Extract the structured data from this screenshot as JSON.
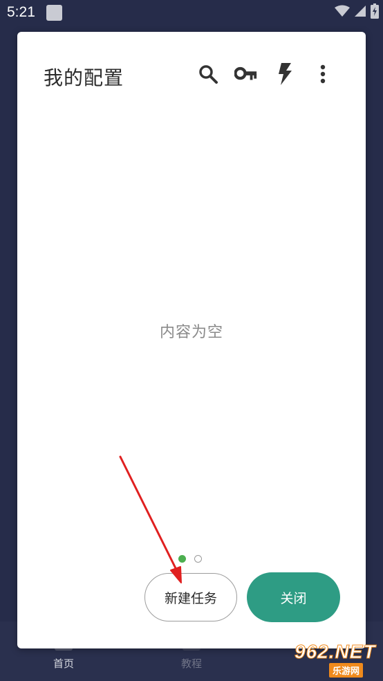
{
  "status_bar": {
    "time": "5:21",
    "icons": [
      "notification-square-icon",
      "wifi-icon",
      "signal-icon",
      "battery-charging-icon"
    ]
  },
  "bottom_nav": {
    "items": [
      {
        "label": "首页",
        "icon": "home-icon"
      },
      {
        "label": "教程",
        "icon": "tutorial-icon"
      }
    ]
  },
  "dialog": {
    "title": "我的配置",
    "toolbar_icons": [
      "search-icon",
      "key-icon",
      "flash-icon",
      "more-vert-icon"
    ],
    "empty_message": "内容为空",
    "pager": {
      "pages": 2,
      "current": 1
    },
    "buttons": {
      "new_task": "新建任务",
      "close": "关闭"
    }
  },
  "colors": {
    "background": "#262c4a",
    "accent": "#2e9c84",
    "pager_active": "#4caf50",
    "annotation": "#e02020"
  },
  "watermark": {
    "brand": "962.NET",
    "sub": "乐游网"
  }
}
